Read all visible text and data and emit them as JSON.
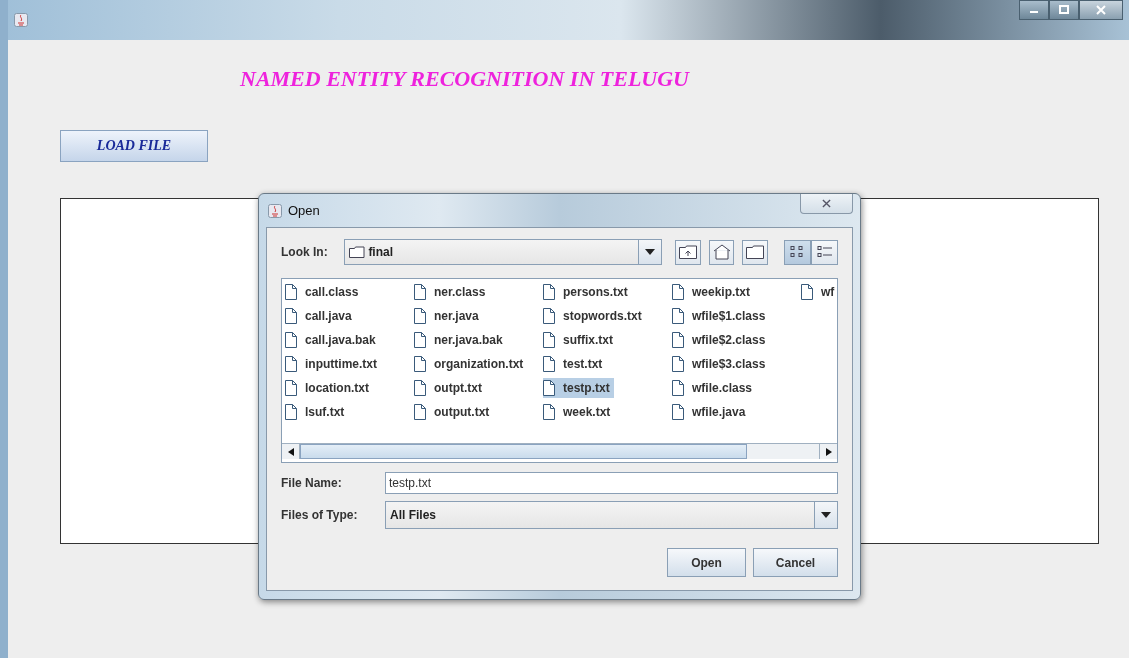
{
  "window": {
    "heading": "NAMED ENTITY RECOGNITION IN TELUGU",
    "load_button": "LOAD FILE"
  },
  "dialog": {
    "title": "Open",
    "look_in_label": "Look In:",
    "look_in_value": "final",
    "view_buttons": [
      {
        "selected": true
      },
      {
        "selected": false
      }
    ],
    "file_columns": [
      [
        {
          "name": "call.class",
          "selected": false
        },
        {
          "name": "call.java",
          "selected": false
        },
        {
          "name": "call.java.bak",
          "selected": false
        },
        {
          "name": "inputtime.txt",
          "selected": false
        },
        {
          "name": "location.txt",
          "selected": false
        },
        {
          "name": "lsuf.txt",
          "selected": false
        }
      ],
      [
        {
          "name": "ner.class",
          "selected": false
        },
        {
          "name": "ner.java",
          "selected": false
        },
        {
          "name": "ner.java.bak",
          "selected": false
        },
        {
          "name": "organization.txt",
          "selected": false
        },
        {
          "name": "outpt.txt",
          "selected": false
        },
        {
          "name": "output.txt",
          "selected": false
        }
      ],
      [
        {
          "name": "persons.txt",
          "selected": false
        },
        {
          "name": "stopwords.txt",
          "selected": false
        },
        {
          "name": "suffix.txt",
          "selected": false
        },
        {
          "name": "test.txt",
          "selected": false
        },
        {
          "name": "testp.txt",
          "selected": true
        },
        {
          "name": "week.txt",
          "selected": false
        }
      ],
      [
        {
          "name": "weekip.txt",
          "selected": false
        },
        {
          "name": "wfile$1.class",
          "selected": false
        },
        {
          "name": "wfile$2.class",
          "selected": false
        },
        {
          "name": "wfile$3.class",
          "selected": false
        },
        {
          "name": "wfile.class",
          "selected": false
        },
        {
          "name": "wfile.java",
          "selected": false
        }
      ],
      [
        {
          "name": "wf",
          "selected": false
        }
      ]
    ],
    "file_name_label": "File Name:",
    "file_name_value": "testp.txt",
    "type_label": "Files of Type:",
    "type_value": "All Files",
    "buttons": [
      "Open",
      "Cancel"
    ]
  }
}
